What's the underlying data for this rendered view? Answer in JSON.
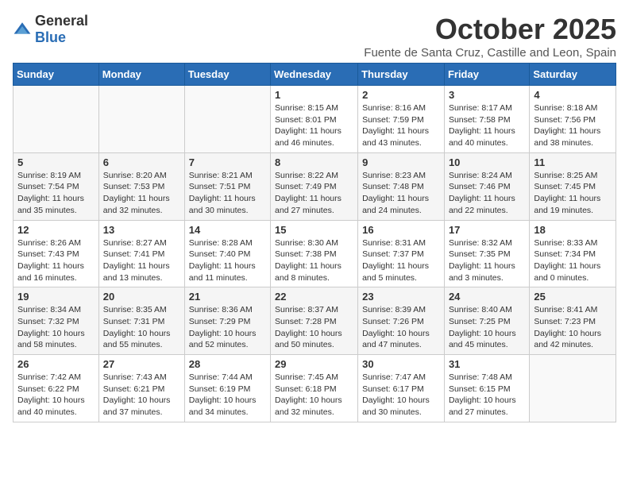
{
  "logo": {
    "general": "General",
    "blue": "Blue"
  },
  "header": {
    "title": "October 2025",
    "subtitle": "Fuente de Santa Cruz, Castille and Leon, Spain"
  },
  "days_of_week": [
    "Sunday",
    "Monday",
    "Tuesday",
    "Wednesday",
    "Thursday",
    "Friday",
    "Saturday"
  ],
  "weeks": [
    [
      {
        "day": "",
        "info": ""
      },
      {
        "day": "",
        "info": ""
      },
      {
        "day": "",
        "info": ""
      },
      {
        "day": "1",
        "info": "Sunrise: 8:15 AM\nSunset: 8:01 PM\nDaylight: 11 hours and 46 minutes."
      },
      {
        "day": "2",
        "info": "Sunrise: 8:16 AM\nSunset: 7:59 PM\nDaylight: 11 hours and 43 minutes."
      },
      {
        "day": "3",
        "info": "Sunrise: 8:17 AM\nSunset: 7:58 PM\nDaylight: 11 hours and 40 minutes."
      },
      {
        "day": "4",
        "info": "Sunrise: 8:18 AM\nSunset: 7:56 PM\nDaylight: 11 hours and 38 minutes."
      }
    ],
    [
      {
        "day": "5",
        "info": "Sunrise: 8:19 AM\nSunset: 7:54 PM\nDaylight: 11 hours and 35 minutes."
      },
      {
        "day": "6",
        "info": "Sunrise: 8:20 AM\nSunset: 7:53 PM\nDaylight: 11 hours and 32 minutes."
      },
      {
        "day": "7",
        "info": "Sunrise: 8:21 AM\nSunset: 7:51 PM\nDaylight: 11 hours and 30 minutes."
      },
      {
        "day": "8",
        "info": "Sunrise: 8:22 AM\nSunset: 7:49 PM\nDaylight: 11 hours and 27 minutes."
      },
      {
        "day": "9",
        "info": "Sunrise: 8:23 AM\nSunset: 7:48 PM\nDaylight: 11 hours and 24 minutes."
      },
      {
        "day": "10",
        "info": "Sunrise: 8:24 AM\nSunset: 7:46 PM\nDaylight: 11 hours and 22 minutes."
      },
      {
        "day": "11",
        "info": "Sunrise: 8:25 AM\nSunset: 7:45 PM\nDaylight: 11 hours and 19 minutes."
      }
    ],
    [
      {
        "day": "12",
        "info": "Sunrise: 8:26 AM\nSunset: 7:43 PM\nDaylight: 11 hours and 16 minutes."
      },
      {
        "day": "13",
        "info": "Sunrise: 8:27 AM\nSunset: 7:41 PM\nDaylight: 11 hours and 13 minutes."
      },
      {
        "day": "14",
        "info": "Sunrise: 8:28 AM\nSunset: 7:40 PM\nDaylight: 11 hours and 11 minutes."
      },
      {
        "day": "15",
        "info": "Sunrise: 8:30 AM\nSunset: 7:38 PM\nDaylight: 11 hours and 8 minutes."
      },
      {
        "day": "16",
        "info": "Sunrise: 8:31 AM\nSunset: 7:37 PM\nDaylight: 11 hours and 5 minutes."
      },
      {
        "day": "17",
        "info": "Sunrise: 8:32 AM\nSunset: 7:35 PM\nDaylight: 11 hours and 3 minutes."
      },
      {
        "day": "18",
        "info": "Sunrise: 8:33 AM\nSunset: 7:34 PM\nDaylight: 11 hours and 0 minutes."
      }
    ],
    [
      {
        "day": "19",
        "info": "Sunrise: 8:34 AM\nSunset: 7:32 PM\nDaylight: 10 hours and 58 minutes."
      },
      {
        "day": "20",
        "info": "Sunrise: 8:35 AM\nSunset: 7:31 PM\nDaylight: 10 hours and 55 minutes."
      },
      {
        "day": "21",
        "info": "Sunrise: 8:36 AM\nSunset: 7:29 PM\nDaylight: 10 hours and 52 minutes."
      },
      {
        "day": "22",
        "info": "Sunrise: 8:37 AM\nSunset: 7:28 PM\nDaylight: 10 hours and 50 minutes."
      },
      {
        "day": "23",
        "info": "Sunrise: 8:39 AM\nSunset: 7:26 PM\nDaylight: 10 hours and 47 minutes."
      },
      {
        "day": "24",
        "info": "Sunrise: 8:40 AM\nSunset: 7:25 PM\nDaylight: 10 hours and 45 minutes."
      },
      {
        "day": "25",
        "info": "Sunrise: 8:41 AM\nSunset: 7:23 PM\nDaylight: 10 hours and 42 minutes."
      }
    ],
    [
      {
        "day": "26",
        "info": "Sunrise: 7:42 AM\nSunset: 6:22 PM\nDaylight: 10 hours and 40 minutes."
      },
      {
        "day": "27",
        "info": "Sunrise: 7:43 AM\nSunset: 6:21 PM\nDaylight: 10 hours and 37 minutes."
      },
      {
        "day": "28",
        "info": "Sunrise: 7:44 AM\nSunset: 6:19 PM\nDaylight: 10 hours and 34 minutes."
      },
      {
        "day": "29",
        "info": "Sunrise: 7:45 AM\nSunset: 6:18 PM\nDaylight: 10 hours and 32 minutes."
      },
      {
        "day": "30",
        "info": "Sunrise: 7:47 AM\nSunset: 6:17 PM\nDaylight: 10 hours and 30 minutes."
      },
      {
        "day": "31",
        "info": "Sunrise: 7:48 AM\nSunset: 6:15 PM\nDaylight: 10 hours and 27 minutes."
      },
      {
        "day": "",
        "info": ""
      }
    ]
  ]
}
